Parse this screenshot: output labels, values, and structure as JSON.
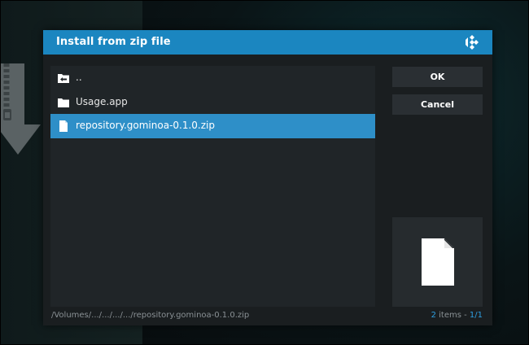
{
  "dialog": {
    "title": "Install from zip file",
    "brand_color": "#1b86c0",
    "selection_color": "#2e8fc8",
    "logo_icon": "kodi-logo-icon"
  },
  "file_list": {
    "items": [
      {
        "label": "..",
        "icon": "folder-back-icon",
        "selected": false
      },
      {
        "label": "Usage.app",
        "icon": "folder-icon",
        "selected": false
      },
      {
        "label": "repository.gominoa-0.1.0.zip",
        "icon": "file-icon",
        "selected": true
      }
    ]
  },
  "buttons": {
    "ok_label": "OK",
    "cancel_label": "Cancel"
  },
  "preview": {
    "icon": "file-icon"
  },
  "footer": {
    "path": "/Volumes/.../.../.../.../repository.gominoa-0.1.0.zip",
    "count": "2",
    "count_suffix": " items - ",
    "page": "1/1"
  }
}
